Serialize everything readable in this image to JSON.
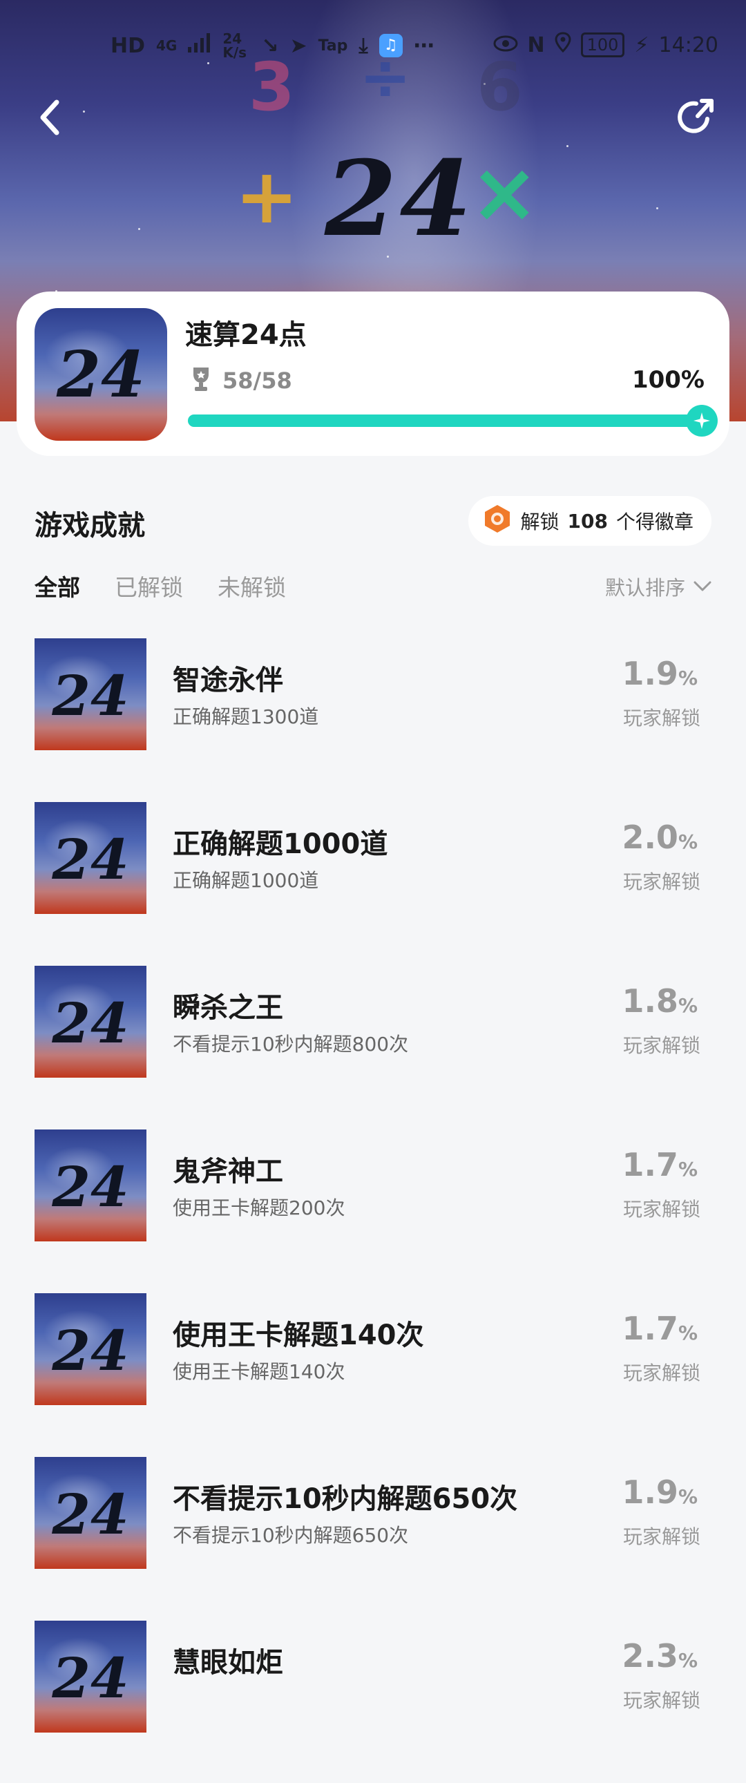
{
  "status_bar": {
    "left_text": [
      "HD",
      "4G",
      "24 K/s",
      "Tap",
      "⋯"
    ],
    "battery": "100",
    "time": "14:20"
  },
  "hero": {
    "number": "24",
    "symbols": [
      "3",
      "÷",
      "6",
      "+",
      "×"
    ]
  },
  "game": {
    "icon_text": "24",
    "title": "速算24点",
    "trophy_count": "58/58",
    "percent_label": "100%",
    "progress_fraction": 1.0
  },
  "achievements": {
    "title": "游戏成就",
    "badge": {
      "prefix": "解锁",
      "count": "108",
      "suffix": "个得徽章"
    },
    "tabs": [
      "全部",
      "已解锁",
      "未解锁"
    ],
    "active_tab": 0,
    "sort_label": "默认排序",
    "unlock_label": "玩家解锁",
    "items": [
      {
        "name": "智途永伴",
        "desc": "正确解题1300道",
        "pct": "1.9"
      },
      {
        "name": "正确解题1000道",
        "desc": "正确解题1000道",
        "pct": "2.0"
      },
      {
        "name": "瞬杀之王",
        "desc": "不看提示10秒内解题800次",
        "pct": "1.8"
      },
      {
        "name": "鬼斧神工",
        "desc": "使用王卡解题200次",
        "pct": "1.7"
      },
      {
        "name": "使用王卡解题140次",
        "desc": "使用王卡解题140次",
        "pct": "1.7"
      },
      {
        "name": "不看提示10秒内解题650次",
        "desc": "不看提示10秒内解题650次",
        "pct": "1.9"
      },
      {
        "name": "慧眼如炬",
        "desc": "",
        "pct": "2.3"
      }
    ]
  },
  "colors": {
    "accent": "#1fd6c0",
    "badge_orange": "#f07a2a"
  }
}
